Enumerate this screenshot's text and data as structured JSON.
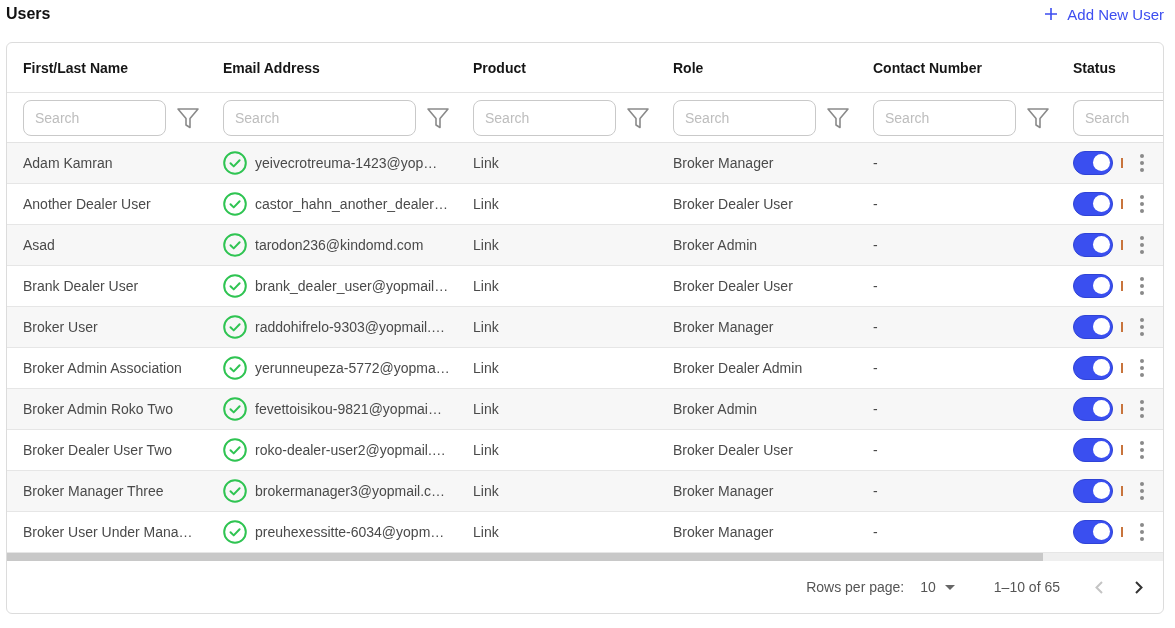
{
  "page": {
    "title": "Users",
    "add_button": {
      "label": "Add New User"
    }
  },
  "table": {
    "columns": [
      {
        "label": "First/Last Name",
        "filter": {
          "placeholder": "Search"
        },
        "filter_button": true
      },
      {
        "label": "Email Address",
        "filter": {
          "placeholder": "Search"
        },
        "filter_button": true
      },
      {
        "label": "Product",
        "filter": {
          "placeholder": "Search"
        },
        "filter_button": true
      },
      {
        "label": "Role",
        "filter": {
          "placeholder": "Search"
        },
        "filter_button": true
      },
      {
        "label": "Contact Number",
        "filter": {
          "placeholder": "Search"
        },
        "filter_button": true
      },
      {
        "label": "Status",
        "filter": {
          "placeholder": "Search"
        },
        "filter_button": false
      }
    ],
    "rows": [
      {
        "name": "Adam Kamran",
        "email": "yeivecrotreuma-1423@yop…",
        "email_verified": true,
        "product": "Link",
        "role": "Broker Manager",
        "contact": "-",
        "active": true
      },
      {
        "name": "Another Dealer User",
        "email": "castor_hahn_another_dealer…",
        "email_verified": true,
        "product": "Link",
        "role": "Broker Dealer User",
        "contact": "-",
        "active": true
      },
      {
        "name": "Asad",
        "email": "tarodon236@kindomd.com",
        "email_verified": true,
        "product": "Link",
        "role": "Broker Admin",
        "contact": "-",
        "active": true
      },
      {
        "name": "Brank Dealer User",
        "email": "brank_dealer_user@yopmail…",
        "email_verified": true,
        "product": "Link",
        "role": "Broker Dealer User",
        "contact": "-",
        "active": true
      },
      {
        "name": "Broker User",
        "email": "raddohifrelo-9303@yopmail.…",
        "email_verified": true,
        "product": "Link",
        "role": "Broker Manager",
        "contact": "-",
        "active": true
      },
      {
        "name": "Broker Admin Association",
        "email": "yerunneupeza-5772@yopma…",
        "email_verified": true,
        "product": "Link",
        "role": "Broker Dealer Admin",
        "contact": "-",
        "active": true
      },
      {
        "name": "Broker Admin Roko Two",
        "email": "fevettoisikou-9821@yopmai…",
        "email_verified": true,
        "product": "Link",
        "role": "Broker Admin",
        "contact": "-",
        "active": true
      },
      {
        "name": "Broker Dealer User Two",
        "email": "roko-dealer-user2@yopmail.…",
        "email_verified": true,
        "product": "Link",
        "role": "Broker Dealer User",
        "contact": "-",
        "active": true
      },
      {
        "name": "Broker Manager Three",
        "email": "brokermanager3@yopmail.c…",
        "email_verified": true,
        "product": "Link",
        "role": "Broker Manager",
        "contact": "-",
        "active": true
      },
      {
        "name": "Broker User Under Mana…",
        "email": "preuhexessitte-6034@yopm…",
        "email_verified": true,
        "product": "Link",
        "role": "Broker Manager",
        "contact": "-",
        "active": true
      }
    ]
  },
  "pagination": {
    "rows_per_page_label": "Rows per page:",
    "rows_per_page": "10",
    "range": "1–10 of 65",
    "prev_disabled": true,
    "next_disabled": false
  }
}
